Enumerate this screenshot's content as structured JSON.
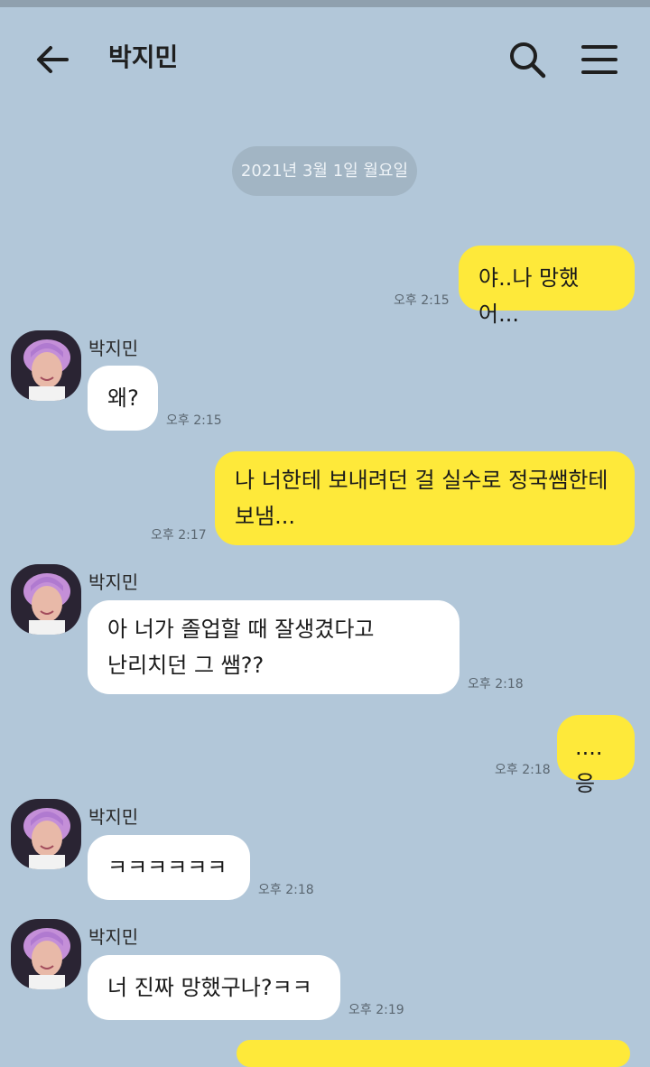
{
  "header": {
    "title": "박지민",
    "back_icon": "back-arrow-icon",
    "search_icon": "search-icon",
    "menu_icon": "hamburger-menu-icon"
  },
  "date_divider": "2021년 3월 1일 월요일",
  "contact": {
    "name": "박지민",
    "avatar_icon": "profile-photo"
  },
  "colors": {
    "background": "#b2c7d9",
    "my_bubble": "#fee93a",
    "their_bubble": "#ffffff"
  },
  "messages": [
    {
      "from": "me",
      "lines": [
        "야..나 망했어..."
      ],
      "time": "오후 2:15"
    },
    {
      "from": "other",
      "sender": "박지민",
      "lines": [
        "왜?"
      ],
      "time": "오후 2:15"
    },
    {
      "from": "me",
      "lines": [
        "나 너한테 보내려던 걸 실수로 정국쌤한테",
        "보냄..."
      ],
      "time": "오후 2:17"
    },
    {
      "from": "other",
      "sender": "박지민",
      "lines": [
        "아 너가 졸업할 때 잘생겼다고",
        "난리치던 그 쌤??"
      ],
      "time": "오후 2:18"
    },
    {
      "from": "me",
      "lines": [
        "....응"
      ],
      "time": "오후 2:18"
    },
    {
      "from": "other",
      "sender": "박지민",
      "lines": [
        "ㅋㅋㅋㅋㅋㅋ"
      ],
      "time": "오후 2:18"
    },
    {
      "from": "other",
      "sender": "박지민",
      "lines": [
        "너 진짜 망했구나?ㅋㅋ"
      ],
      "time": "오후 2:19"
    }
  ]
}
